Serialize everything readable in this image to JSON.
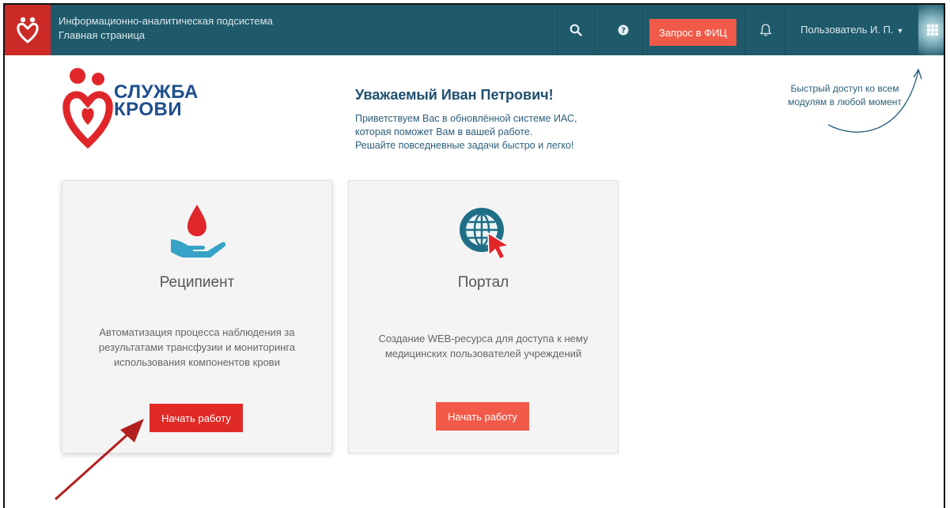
{
  "topbar": {
    "title_line1": "Информационно-аналитическая подсистема",
    "title_line2": "Главная страница",
    "request_button": "Запрос в ФИЦ",
    "user_label": "Пользователь И. П.",
    "icons": [
      "logo-icon",
      "search-icon",
      "help-icon",
      "bell-icon",
      "chevron-down-icon",
      "apps-grid-icon"
    ]
  },
  "brand": {
    "line1": "СЛУЖБА",
    "line2": "КРОВИ"
  },
  "greeting": {
    "title": "Уважаемый Иван Петрович!",
    "line1": "Приветствуем Вас в обновлённой системе ИАС,",
    "line2": "которая поможет Вам в вашей работе.",
    "line3": "Решайте повседневные задачи быстро и легко!"
  },
  "quick_access": {
    "line1": "Быстрый доступ ко всем",
    "line2": "модулям в любой момент"
  },
  "cards": [
    {
      "title": "Реципиент",
      "desc_line1": "Автоматизация процесса наблюдения за",
      "desc_line2": "результатами трансфузии и мониторинга",
      "desc_line3": "использования компонентов крови",
      "button": "Начать работу",
      "icon": "blood-drop-hand-icon"
    },
    {
      "title": "Портал",
      "desc_line1": "Создание WEB-ресурса для доступа к нему",
      "desc_line2": "медицинских пользователей учреждений",
      "button": "Начать работу",
      "icon": "globe-cursor-icon"
    }
  ],
  "colors": {
    "topbar": "#1f5a6b",
    "accent_red": "#e02a26",
    "request_button": "#f15a48",
    "brand_blue": "#1e4f8f"
  }
}
